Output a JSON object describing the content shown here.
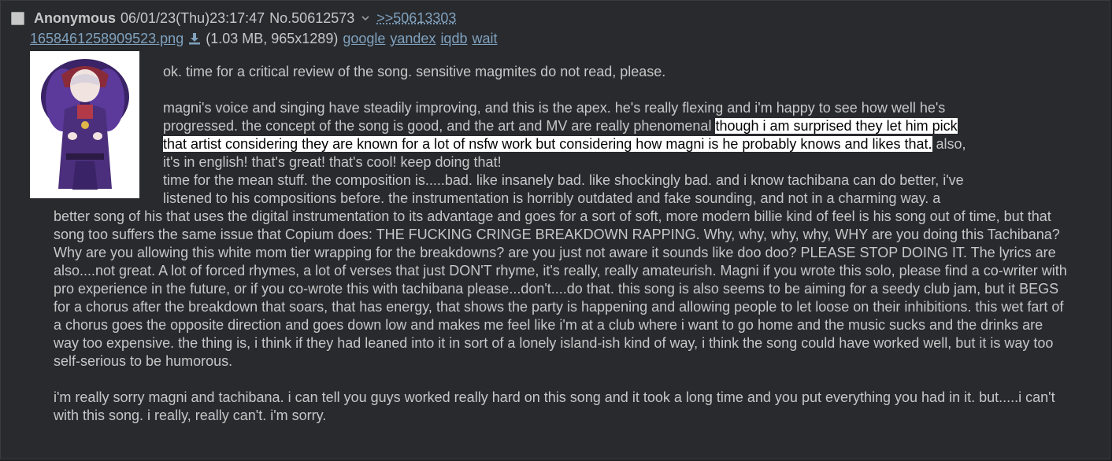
{
  "post": {
    "name": "Anonymous",
    "datetime": "06/01/23(Thu)23:17:47",
    "number": "No.50612573",
    "backlink": ">>50613303",
    "file": {
      "filename": "1658461258909523.png",
      "info": "(1.03 MB, 965x1289)",
      "search_links": [
        "google",
        "yandex",
        "iqdb",
        "wait"
      ]
    },
    "body": {
      "p1": "ok. time for a critical review of the song. sensitive magmites do not read, please.",
      "p2a": "magni's voice and singing have steadily improving, and this is the apex. he's really flexing and i'm happy to see how well he's",
      "p2b": "progressed. the concept of the song is good, and the art and MV are really phenomenal ",
      "p2_hl1": "though i am surprised they let him pick",
      "p2_hl2": "that artist considering they are known for a lot of nsfw work but considering how magni is he probably knows and likes that.",
      "p2c": " also,",
      "p2d": "it's in english! that's great! that's cool! keep doing that!",
      "p3a": "time for the mean stuff. the composition is.....bad. like insanely bad. like shockingly bad. and i know tachibana can do better, i've",
      "p3b": "listened to his compositions before. the instrumentation is horribly outdated and fake sounding, and not in a charming way. a",
      "p3rest": "better song of his that uses the digital instrumentation to its advantage and goes for a sort of soft, more modern billie kind of feel is his song out of time, but that song too suffers the same issue that Copium does: THE FUCKING CRINGE BREAKDOWN RAPPING. Why, why, why, why, WHY are you doing this Tachibana? Why are you allowing this white mom tier wrapping for the breakdowns? are you just not aware it sounds like doo doo? PLEASE STOP DOING IT. The lyrics are also....not great. A lot of forced rhymes, a lot of verses that just DON'T rhyme, it's really, really amateurish. Magni if you wrote this solo, please find a co-writer with pro experience in the future, or if you co-wrote this with tachibana please...don't....do that. this song is also seems to be aiming for a seedy club jam, but it BEGS for a chorus after the breakdown that soars, that has energy, that shows the party is happening and allowing people to let loose on their inhibitions. this wet fart of a chorus goes the opposite direction and goes down low and makes me feel like i'm at a club where i want to go home and the music sucks and the drinks are way too expensive. the thing is, i think if they had leaned into it in sort of a lonely island-ish kind of way, i think the song could have worked well, but it is way too self-serious to be humorous.",
      "p4": "i'm really sorry magni and tachibana. i can tell you guys worked really hard on this song and it took a long time and you put everything you had in it. but.....i can't with this song. i really, really can't. i'm sorry."
    }
  },
  "colors": {
    "background": "#282a2e",
    "text": "#c5c8c6",
    "link": "#81a2be",
    "highlight_bg": "#ffffff"
  },
  "icons": [
    "checkbox-icon",
    "chevron-down-icon",
    "download-icon"
  ]
}
